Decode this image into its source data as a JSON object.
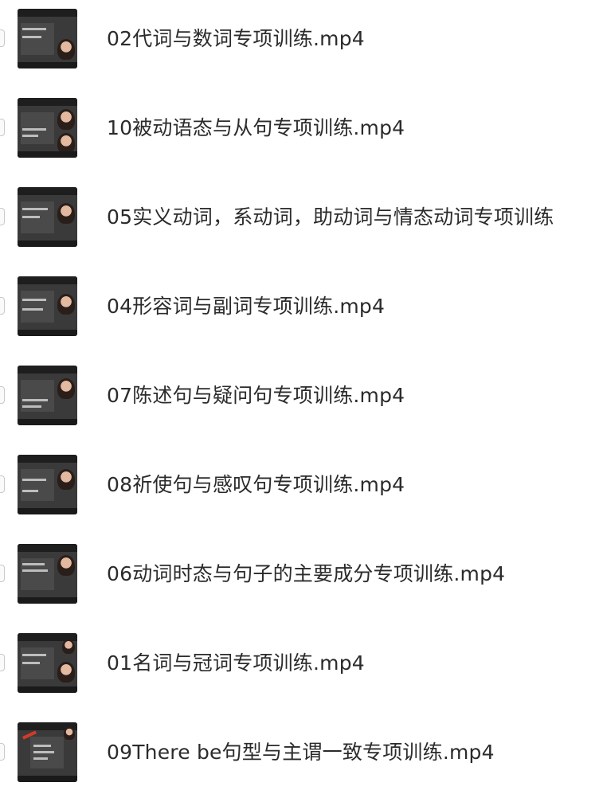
{
  "files": [
    {
      "name": "02代词与数词专项训练.mp4",
      "thumbnail_icon": "video-thumbnail-icon"
    },
    {
      "name": "10被动语态与从句专项训练.mp4",
      "thumbnail_icon": "video-thumbnail-icon"
    },
    {
      "name": "05实义动词，系动词，助动词与情态动词专项训练",
      "thumbnail_icon": "video-thumbnail-icon"
    },
    {
      "name": "04形容词与副词专项训练.mp4",
      "thumbnail_icon": "video-thumbnail-icon"
    },
    {
      "name": "07陈述句与疑问句专项训练.mp4",
      "thumbnail_icon": "video-thumbnail-icon"
    },
    {
      "name": "08祈使句与感叹句专项训练.mp4",
      "thumbnail_icon": "video-thumbnail-icon"
    },
    {
      "name": "06动词时态与句子的主要成分专项训练.mp4",
      "thumbnail_icon": "video-thumbnail-icon"
    },
    {
      "name": "01名词与冠词专项训练.mp4",
      "thumbnail_icon": "video-thumbnail-icon"
    },
    {
      "name": "09There be句型与主谓一致专项训练.mp4",
      "thumbnail_icon": "video-thumbnail-icon"
    }
  ]
}
